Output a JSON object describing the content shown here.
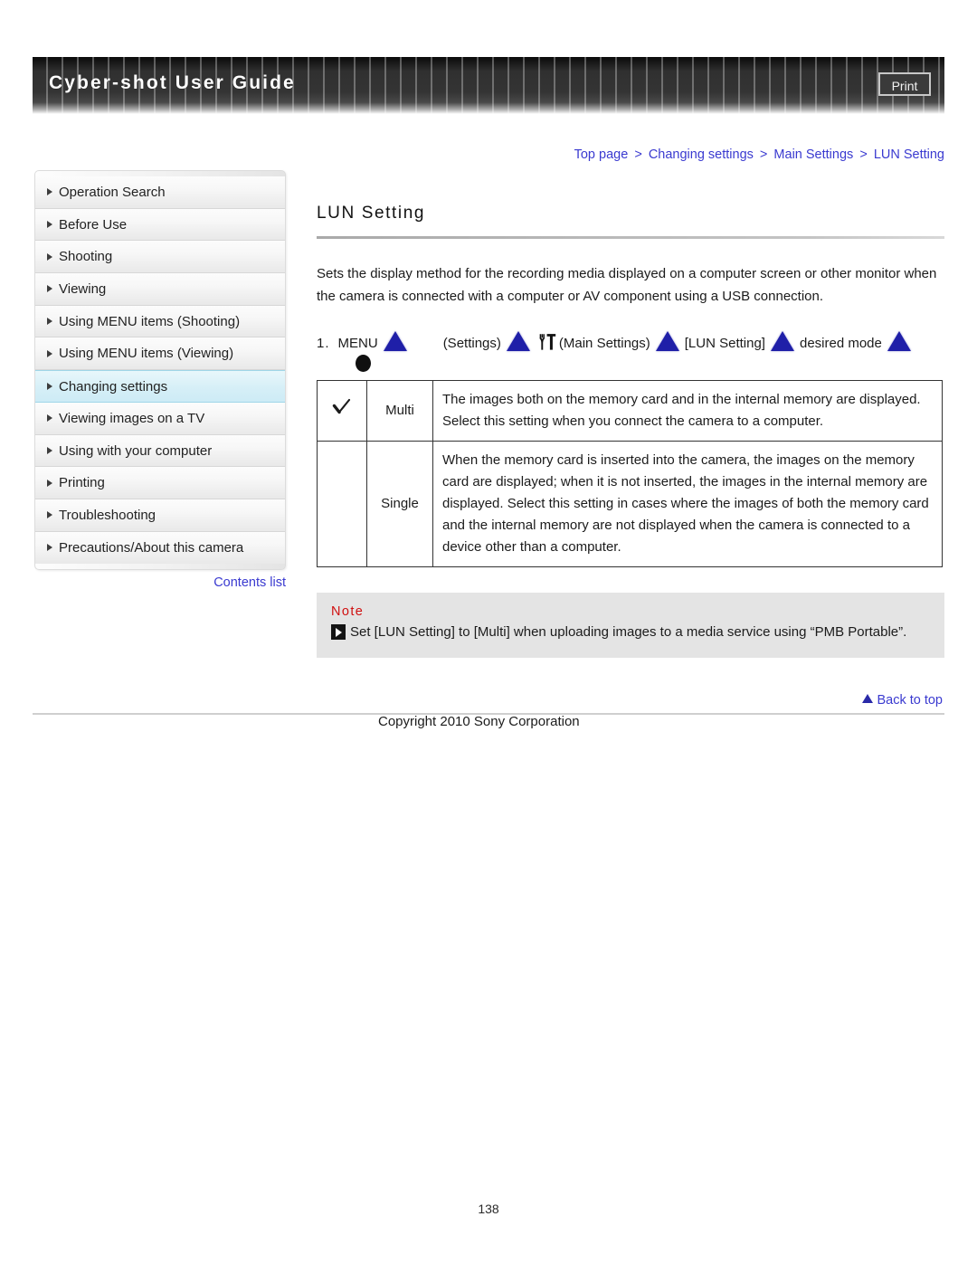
{
  "header": {
    "title": "Cyber-shot User Guide",
    "print_label": "Print"
  },
  "breadcrumb": {
    "separator": ">",
    "items": [
      {
        "label": "Top page"
      },
      {
        "label": "Changing settings"
      },
      {
        "label": "Main Settings"
      },
      {
        "label": "LUN Setting"
      }
    ]
  },
  "sidebar": {
    "items": [
      {
        "label": "Operation Search",
        "active": false
      },
      {
        "label": "Before Use",
        "active": false
      },
      {
        "label": "Shooting",
        "active": false
      },
      {
        "label": "Viewing",
        "active": false
      },
      {
        "label": "Using MENU items (Shooting)",
        "active": false
      },
      {
        "label": "Using MENU items (Viewing)",
        "active": false
      },
      {
        "label": "Changing settings",
        "active": true
      },
      {
        "label": "Viewing images on a TV",
        "active": false
      },
      {
        "label": "Using with your computer",
        "active": false
      },
      {
        "label": "Printing",
        "active": false
      },
      {
        "label": "Troubleshooting",
        "active": false
      },
      {
        "label": "Precautions/About this camera",
        "active": false
      }
    ],
    "contents_link": "Contents list"
  },
  "main": {
    "title": "LUN Setting",
    "intro": "Sets the display method for the recording media displayed on a computer screen or other monitor when the camera is connected with a computer or AV component using a USB connection.",
    "step": {
      "number": "1.",
      "part1": "MENU",
      "part2": "(Settings)",
      "part3": "(Main Settings)",
      "part4": "[LUN Setting]",
      "part5": "desired mode"
    },
    "table": {
      "rows": [
        {
          "checked": true,
          "name": "Multi",
          "description": "The images both on the memory card and in the internal memory are displayed. Select this setting when you connect the camera to a computer."
        },
        {
          "checked": false,
          "name": "Single",
          "description": "When the memory card is inserted into the camera, the images on the memory card are displayed; when it is not inserted, the images in the internal memory are displayed. Select this setting in cases where the images of both the memory card and the internal memory are not displayed when the camera is connected to a device other than a computer."
        }
      ]
    },
    "note": {
      "heading": "Note",
      "text": "Set [LUN Setting] to [Multi] when uploading images to a media service using “PMB Portable”."
    }
  },
  "footer": {
    "back_to_top": "Back to top",
    "copyright": "Copyright 2010 Sony Corporation",
    "page_number": "138"
  },
  "colors": {
    "link": "#3a3ad0",
    "note_heading": "#d01010",
    "triangle_blue": "#1f1fa8",
    "sidebar_active": "#cdebf6",
    "note_bg": "#e4e4e4"
  }
}
